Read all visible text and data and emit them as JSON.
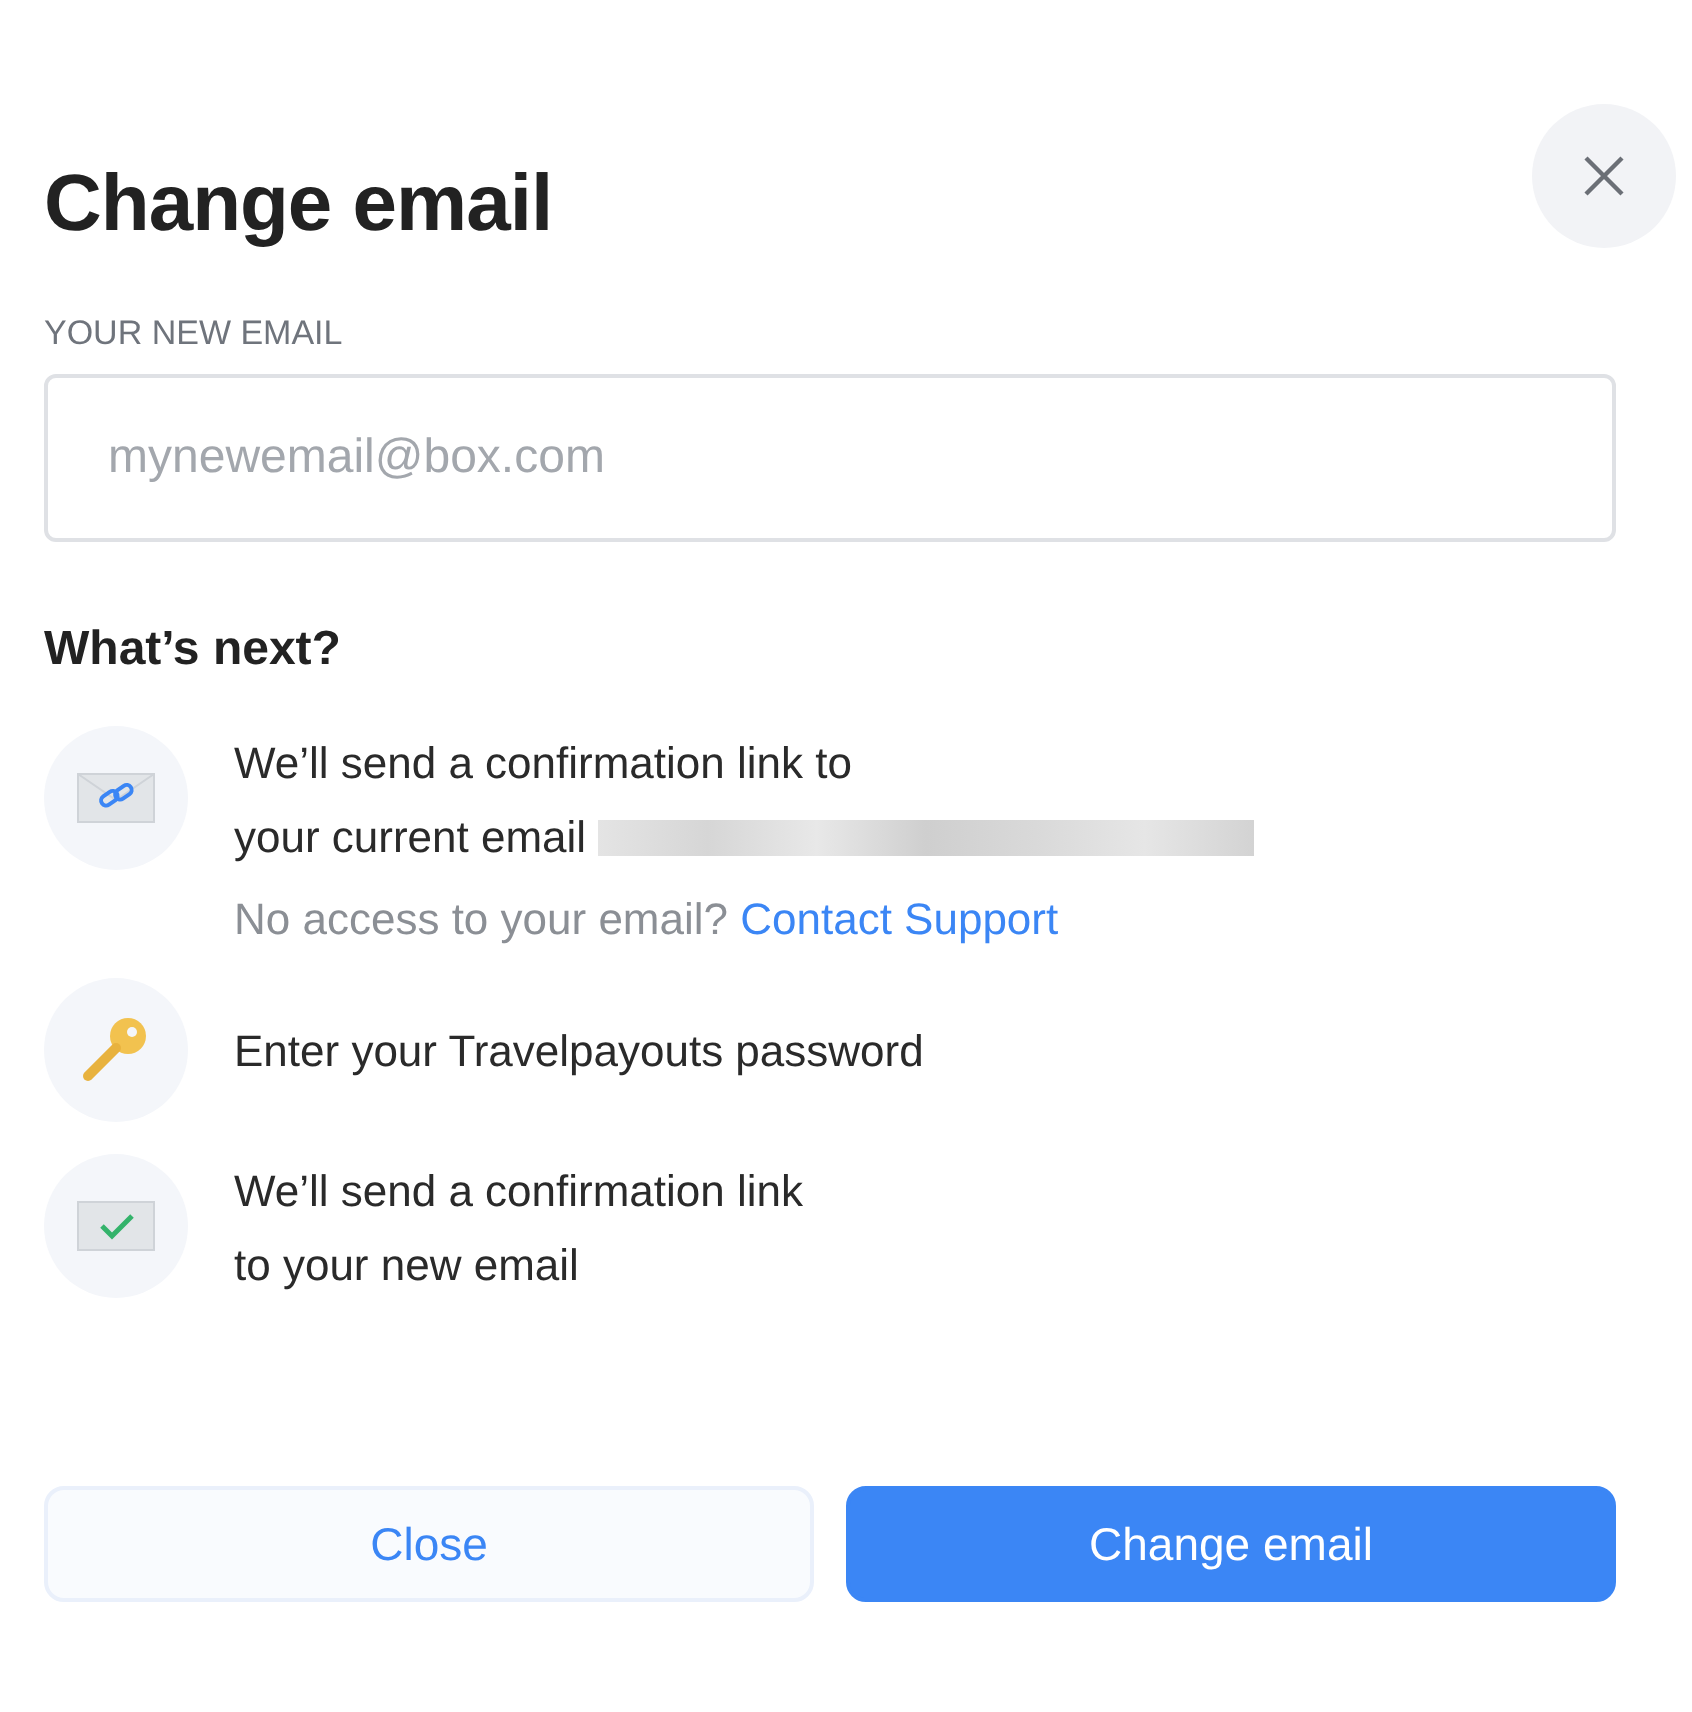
{
  "dialog": {
    "title": "Change email"
  },
  "email_field": {
    "label": "YOUR NEW EMAIL",
    "placeholder": "mynewemail@box.com"
  },
  "next": {
    "heading": "What’s next?",
    "steps": [
      {
        "kind": "link-envelope",
        "lines": [
          "We’ll send a confirmation link to",
          "your current email"
        ],
        "redacted": true,
        "note": {
          "text": "No access to your email?",
          "link": "Contact Support"
        }
      },
      {
        "kind": "key",
        "lines": [
          "Enter your Travelpayouts password"
        ]
      },
      {
        "kind": "check-envelope",
        "lines": [
          "We’ll send a confirmation link",
          "to your new email"
        ]
      }
    ]
  },
  "buttons": [
    {
      "label": "Close",
      "kind": "secondary"
    },
    {
      "label": "Change email",
      "kind": "primary"
    }
  ]
}
